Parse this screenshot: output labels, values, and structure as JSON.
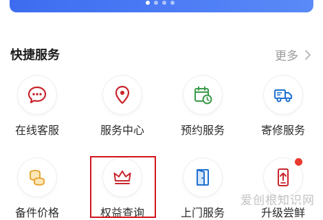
{
  "banner": {
    "dots": 4,
    "active_dot": 0
  },
  "section": {
    "title": "快捷服务",
    "more_label": "更多"
  },
  "tiles": [
    {
      "label": "在线客服",
      "icon": "chat-bubble-icon"
    },
    {
      "label": "服务中心",
      "icon": "location-pin-icon"
    },
    {
      "label": "预约服务",
      "icon": "calendar-clock-icon"
    },
    {
      "label": "寄修服务",
      "icon": "truck-icon"
    },
    {
      "label": "备件价格",
      "icon": "coins-stack-icon"
    },
    {
      "label": "权益查询",
      "icon": "crown-icon"
    },
    {
      "label": "上门服务",
      "icon": "door-icon"
    },
    {
      "label": "升级尝鲜",
      "icon": "phone-upgrade-icon"
    }
  ],
  "watermark": "爱创根知识网",
  "colors": {
    "red": "#c8242c",
    "green": "#3a9a4a",
    "blue": "#1e6fd0",
    "orange": "#e7a12b",
    "badge": "#e8392f"
  }
}
